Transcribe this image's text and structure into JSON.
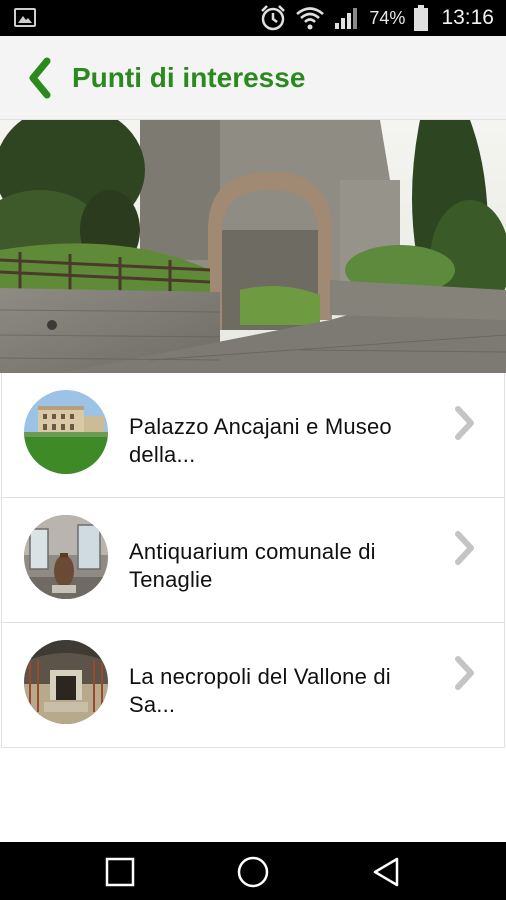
{
  "status_bar": {
    "battery_percent": "74%",
    "time": "13:16",
    "icons": [
      "image-notification-icon",
      "alarm-icon",
      "wifi-icon",
      "signal-icon",
      "battery-icon"
    ]
  },
  "header": {
    "title": "Punti di interesse",
    "back_icon": "chevron-left-icon",
    "accent_color": "#2b8a1e"
  },
  "hero": {
    "image": "castle-arch-photo"
  },
  "poi_list": [
    {
      "title": "Palazzo Ancajani e Museo della...",
      "thumbnail": "palazzo-photo"
    },
    {
      "title": "Antiquarium comunale di Tenaglie",
      "thumbnail": "museum-interior-photo"
    },
    {
      "title": "La necropoli del Vallone di Sa...",
      "thumbnail": "necropolis-photo"
    }
  ],
  "nav_bar": {
    "buttons": [
      "recents-icon",
      "home-icon",
      "back-icon"
    ]
  }
}
